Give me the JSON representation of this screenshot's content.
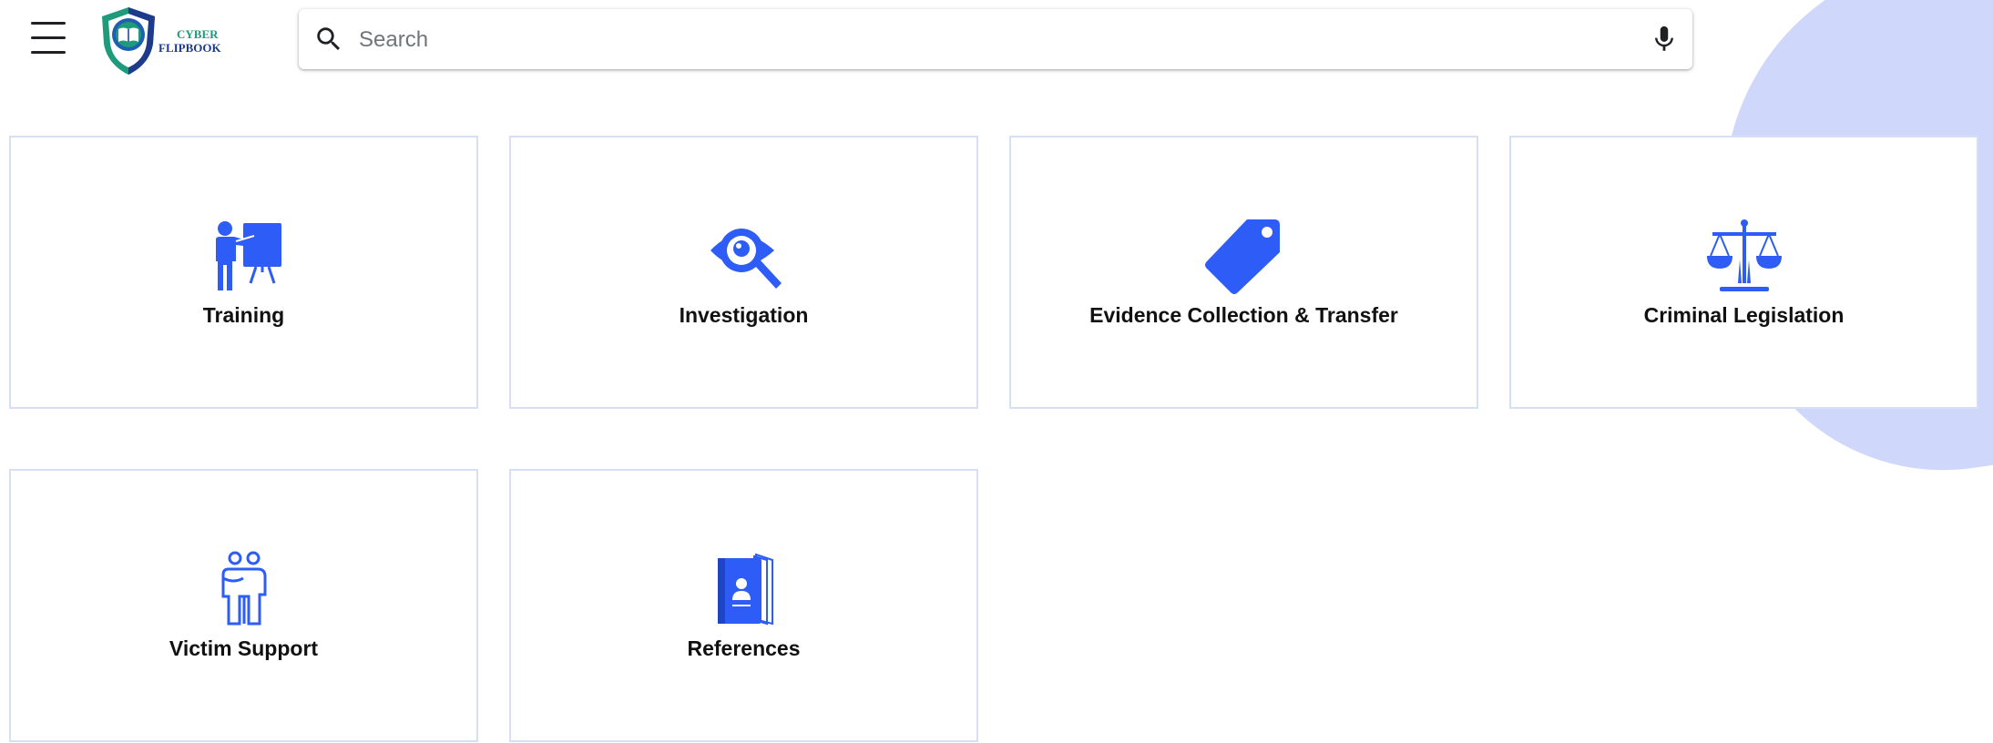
{
  "app": {
    "logo": {
      "line1": "CYBER",
      "line2": "FLIPBOOK"
    }
  },
  "search": {
    "placeholder": "Search",
    "value": ""
  },
  "icons": {
    "menu": "hamburger-menu-icon",
    "search": "search-icon",
    "mic": "microphone-icon"
  },
  "colors": {
    "accent": "#2d5cf6",
    "card_border": "#d6e0f5",
    "blob": "#cfd8fa",
    "logo_teal": "#1f9a7a",
    "logo_navy": "#1e3a8a"
  },
  "categories": [
    {
      "label": "Training",
      "icon": "teacher-presentation-icon"
    },
    {
      "label": "Investigation",
      "icon": "eye-magnifier-icon"
    },
    {
      "label": "Evidence Collection & Transfer",
      "icon": "tag-icon"
    },
    {
      "label": "Criminal Legislation",
      "icon": "balance-scale-icon"
    },
    {
      "label": "Victim Support",
      "icon": "people-support-icon"
    },
    {
      "label": "References",
      "icon": "reference-book-icon"
    }
  ]
}
